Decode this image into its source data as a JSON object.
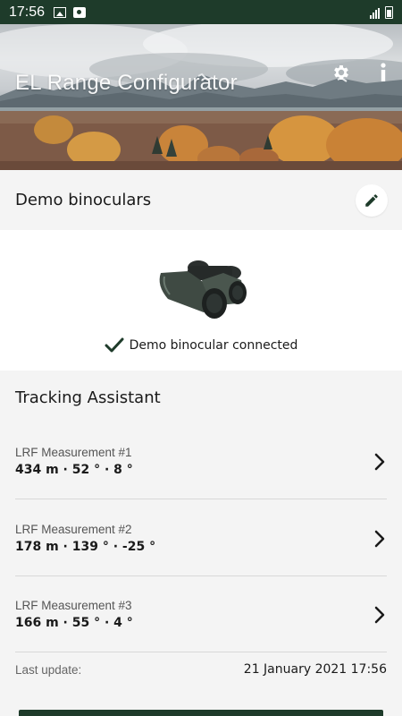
{
  "status_bar": {
    "time": "17:56",
    "icons": [
      "photo-icon",
      "media-icon",
      "signal-icon",
      "battery-icon"
    ]
  },
  "header": {
    "title": "EL Range Configurator",
    "settings_icon": "gear-icon",
    "info_icon": "info-icon"
  },
  "device": {
    "name": "Demo binoculars",
    "edit_icon": "pencil-icon",
    "status": "Demo binocular connected",
    "status_icon": "checkmark-icon"
  },
  "tracking": {
    "title": "Tracking Assistant",
    "measurements": [
      {
        "label": "LRF Measurement #1",
        "value": "434 m · 52 ° · 8 °"
      },
      {
        "label": "LRF Measurement #2",
        "value": "178 m · 139 ° · -25 °"
      },
      {
        "label": "LRF Measurement #3",
        "value": "166 m · 55 ° · 4 °"
      }
    ],
    "last_update_label": "Last update:",
    "last_update_value": "21 January 2021 17:56"
  },
  "colors": {
    "brand_dark_green": "#1e3b2a",
    "background": "#f4f4f4",
    "card": "#ffffff"
  }
}
